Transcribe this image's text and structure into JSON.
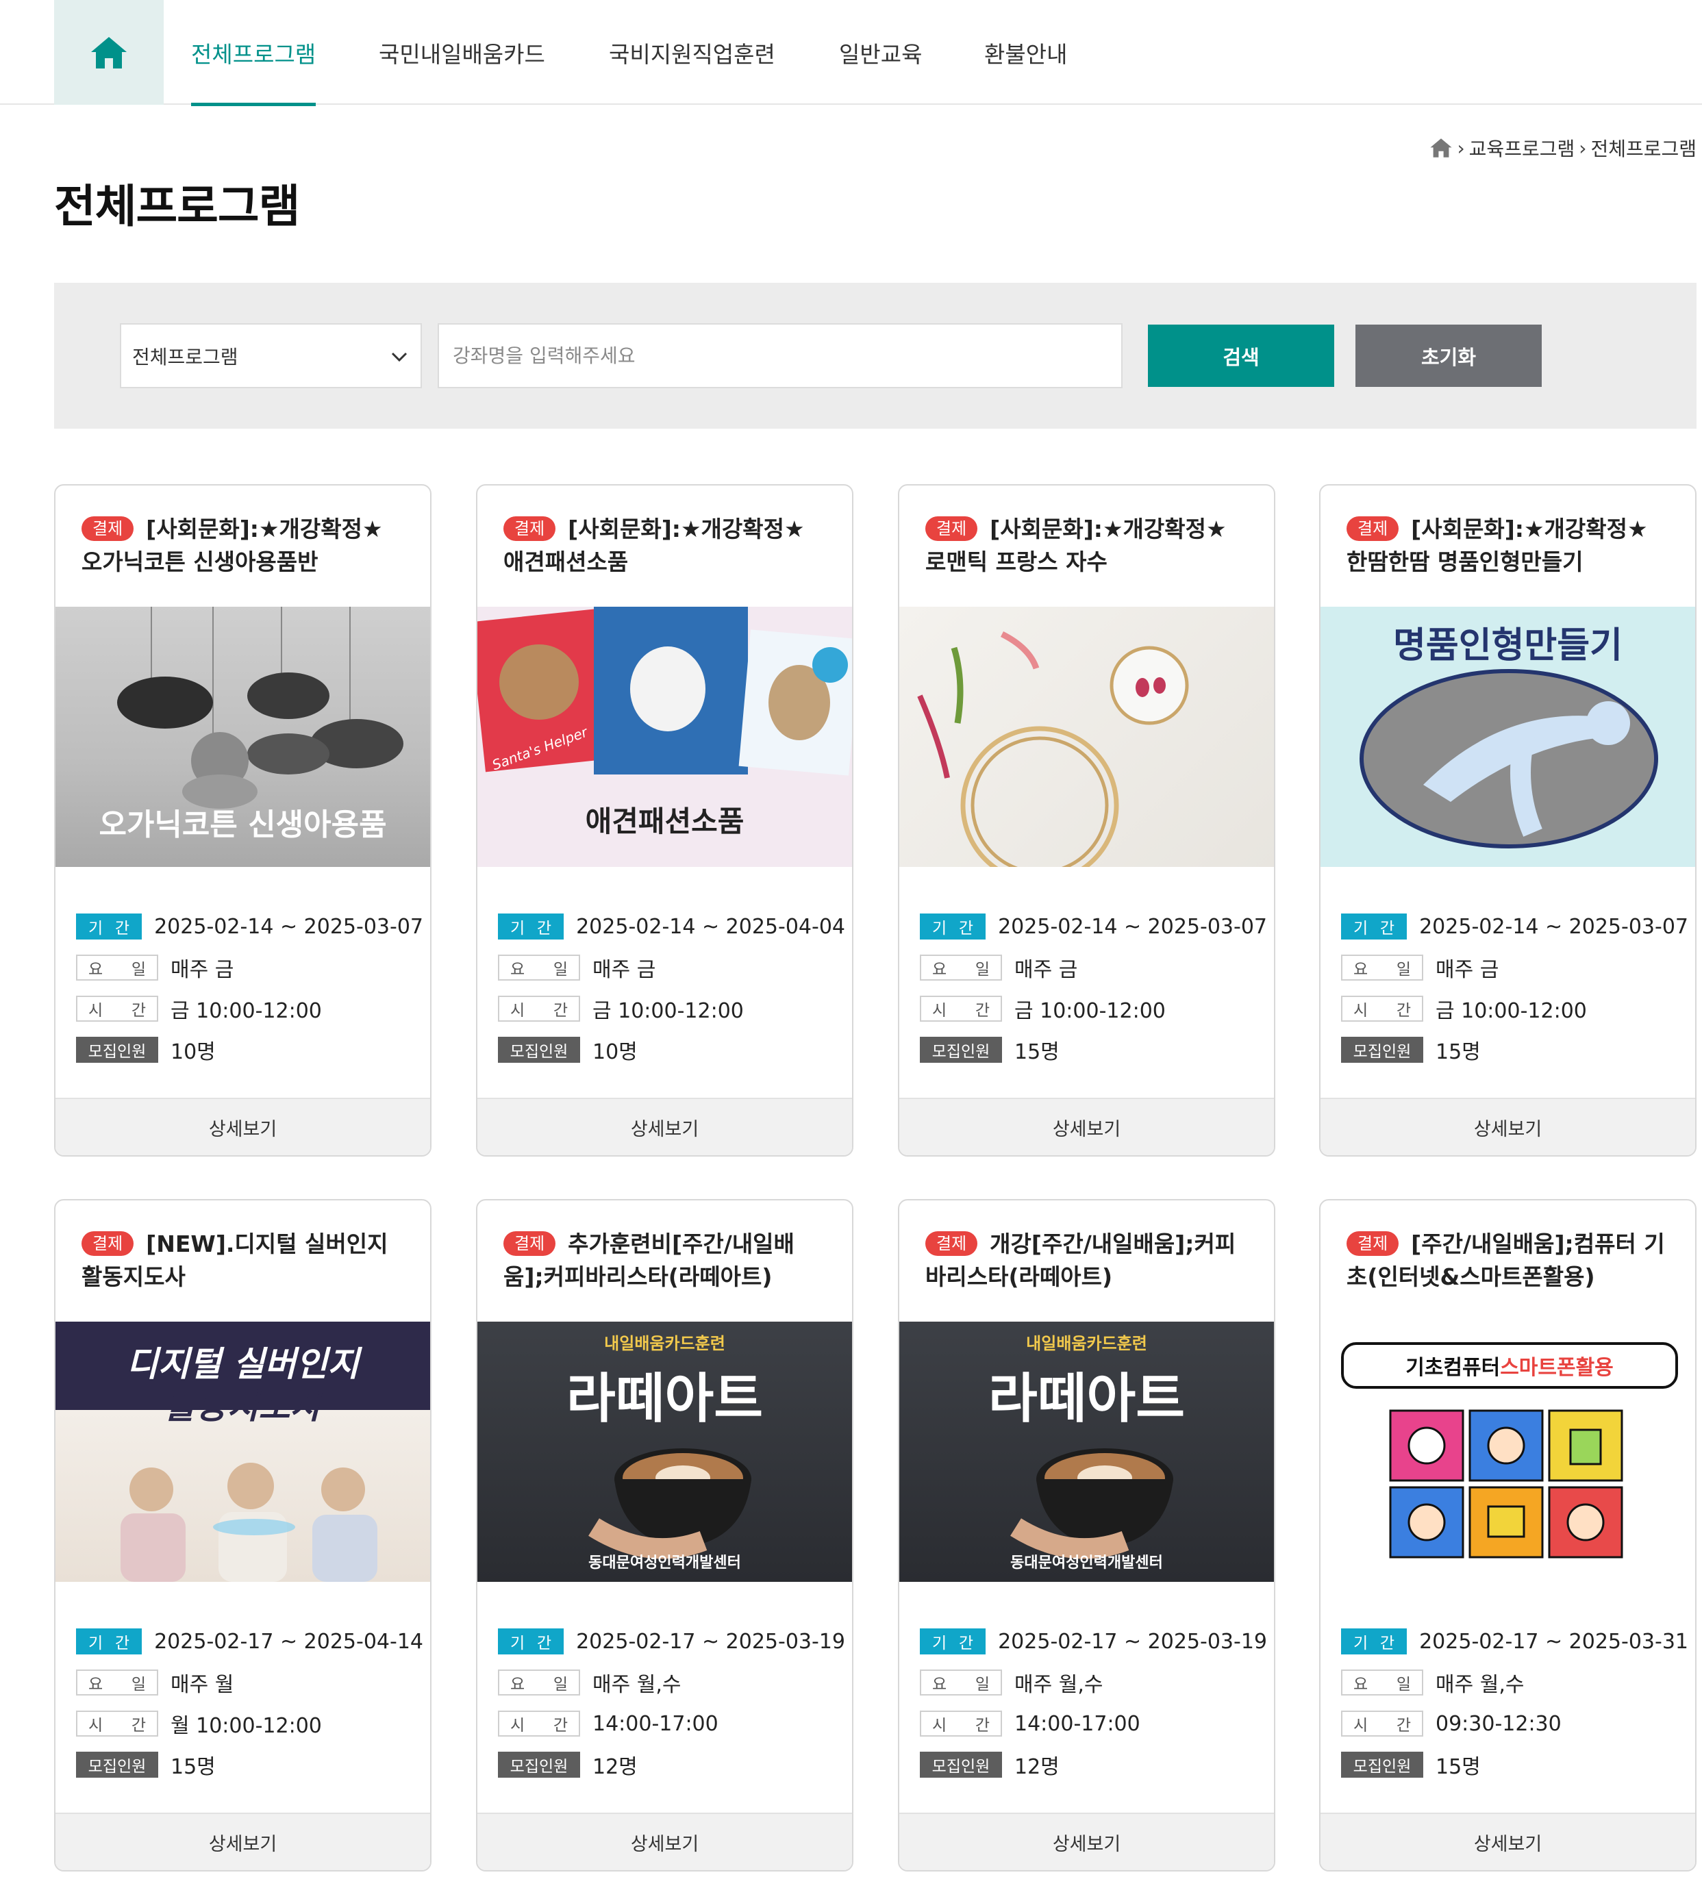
{
  "nav": {
    "items": [
      "전체프로그램",
      "국민내일배움카드",
      "국비지원직업훈련",
      "일반교육",
      "환불안내"
    ]
  },
  "breadcrumb": [
    "교육프로그램",
    "전체프로그램"
  ],
  "page_title": "전체프로그램",
  "search": {
    "select_value": "전체프로그램",
    "placeholder": "강좌명을 입력해주세요",
    "search_label": "검색",
    "reset_label": "초기화"
  },
  "labels": {
    "period": [
      "기",
      "간"
    ],
    "day": [
      "요",
      "일"
    ],
    "time": [
      "시",
      "간"
    ],
    "recruit": "모집인원",
    "detail": "상세보기",
    "pay_badge": "결제"
  },
  "colors": {
    "accent": "#00918a",
    "badge": "#e8433f",
    "period_label": "#10a6c9",
    "reset_button": "#6d6f74"
  },
  "cards": [
    {
      "title": "[사회문화]:★개강확정★ 오가닉코튼 신생아용품반",
      "image_caption": "오가닉코튼 신생아용품",
      "period": "2025-02-14 ~ 2025-03-07",
      "day": "매주 금",
      "time": "금 10:00-12:00",
      "recruit": "10명"
    },
    {
      "title": "[사회문화]:★개강확정★ 애견패션소품",
      "image_caption": "애견패션소품",
      "image_subtext": "Santa's Helper",
      "period": "2025-02-14 ~ 2025-04-04",
      "day": "매주 금",
      "time": "금 10:00-12:00",
      "recruit": "10명"
    },
    {
      "title": "[사회문화]:★개강확정★ 로맨틱 프랑스 자수",
      "image_caption": "",
      "period": "2025-02-14 ~ 2025-03-07",
      "day": "매주 금",
      "time": "금 10:00-12:00",
      "recruit": "15명"
    },
    {
      "title": "[사회문화]:★개강확정★ 한땀한땀 명품인형만들기",
      "image_caption": "명품인형만들기",
      "period": "2025-02-14 ~ 2025-03-07",
      "day": "매주 금",
      "time": "금 10:00-12:00",
      "recruit": "15명"
    },
    {
      "title": "[NEW].디지털 실버인지 활동지도사",
      "image_caption": "디지털 실버인지",
      "image_caption2": "활동지도사",
      "period": "2025-02-17 ~ 2025-04-14",
      "day": "매주 월",
      "time": "월 10:00-12:00",
      "recruit": "15명"
    },
    {
      "title": "추가훈련비[주간/내일배움];커피바리스타(라떼아트)",
      "image_top": "내일배움카드훈련",
      "image_caption": "라떼아트",
      "image_bottom": "동대문여성인력개발센터",
      "period": "2025-02-17 ~ 2025-03-19",
      "day": "매주 월,수",
      "time": "14:00-17:00",
      "recruit": "12명"
    },
    {
      "title": "개강[주간/내일배움];커피바리스타(라떼아트)",
      "image_top": "내일배움카드훈련",
      "image_caption": "라떼아트",
      "image_bottom": "동대문여성인력개발센터",
      "period": "2025-02-17 ~ 2025-03-19",
      "day": "매주 월,수",
      "time": "14:00-17:00",
      "recruit": "12명"
    },
    {
      "title": "[주간/내일배움];컴퓨터 기초(인터넷&스마트폰활용)",
      "image_caption": "기초컴퓨터",
      "image_caption2": "스마트폰활용",
      "period": "2025-02-17 ~ 2025-03-31",
      "day": "매주 월,수",
      "time": "09:30-12:30",
      "recruit": "15명"
    }
  ]
}
